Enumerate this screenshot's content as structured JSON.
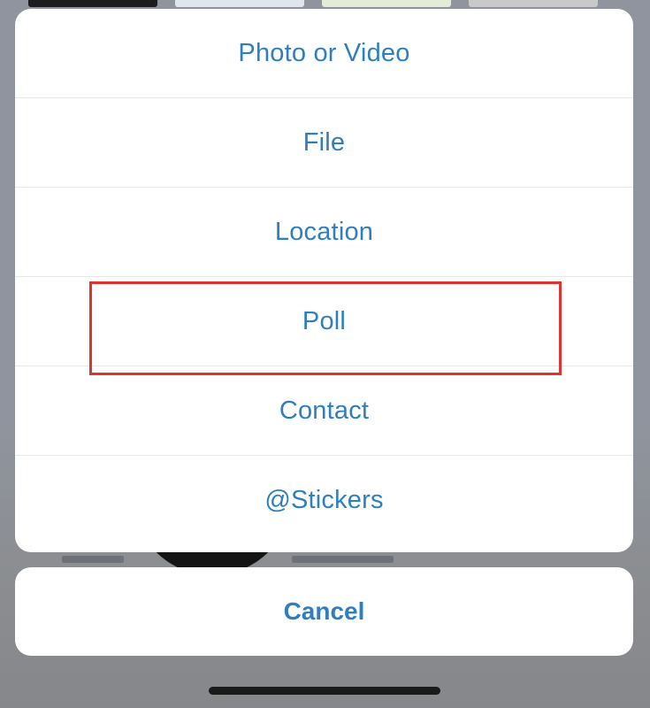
{
  "action_sheet": {
    "items": [
      {
        "label": "Photo or Video"
      },
      {
        "label": "File"
      },
      {
        "label": "Location"
      },
      {
        "label": "Poll"
      },
      {
        "label": "Contact"
      },
      {
        "label": "@Stickers"
      }
    ],
    "highlighted_item": "Poll",
    "highlight_color": "#e0322f",
    "item_text_color": "#2f7fc0"
  },
  "cancel": {
    "label": "Cancel"
  }
}
